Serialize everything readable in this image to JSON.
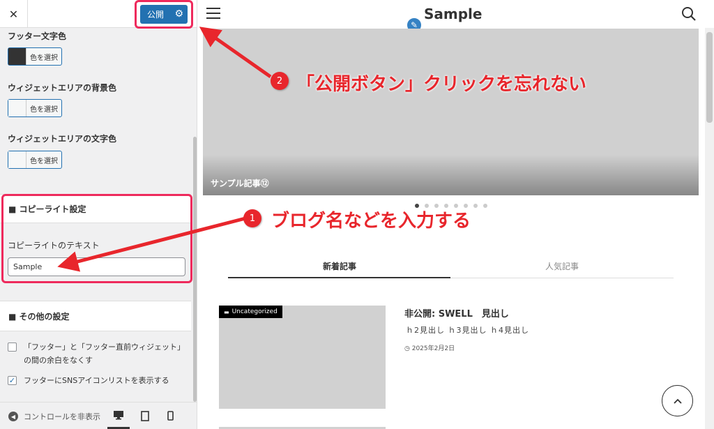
{
  "sidebar": {
    "close_label": "✕",
    "publish_label": "公開",
    "footer_text_color": {
      "label": "フッター文字色",
      "button": "色を選択"
    },
    "widget_bg_color": {
      "label": "ウィジェットエリアの背景色",
      "button": "色を選択"
    },
    "widget_text_color": {
      "label": "ウィジェットエリアの文字色",
      "button": "色を選択"
    },
    "copyright_section": "■ コピーライト設定",
    "copyright_text_label": "コピーライトのテキスト",
    "copyright_text_value": "Sample",
    "other_section": "■ その他の設定",
    "checkbox_1": "「フッター」と「フッター直前ウィジェット」の間の余白をなくす",
    "checkbox_2": "フッターにSNSアイコンリストを表示する",
    "hide_controls": "コントロールを非表示"
  },
  "preview": {
    "site_title": "Sample",
    "hero_caption": "サンプル記事⑫",
    "tabs": [
      "新着記事",
      "人気記事"
    ],
    "card": {
      "category": "Uncategorized",
      "title": "非公開: SWELL　見出し",
      "excerpt": "ｈ2見出し ｈ3見出し ｈ4見出し",
      "date": "2025年2月2日"
    }
  },
  "annotations": {
    "note_1_num": "1",
    "note_1_text": "ブログ名などを入力する",
    "note_2_num": "2",
    "note_2_text": "「公開ボタン」クリックを忘れない"
  },
  "colors": {
    "accent": "#2271b1",
    "annotation": "#e8262c",
    "highlight": "#ee2a5c"
  }
}
